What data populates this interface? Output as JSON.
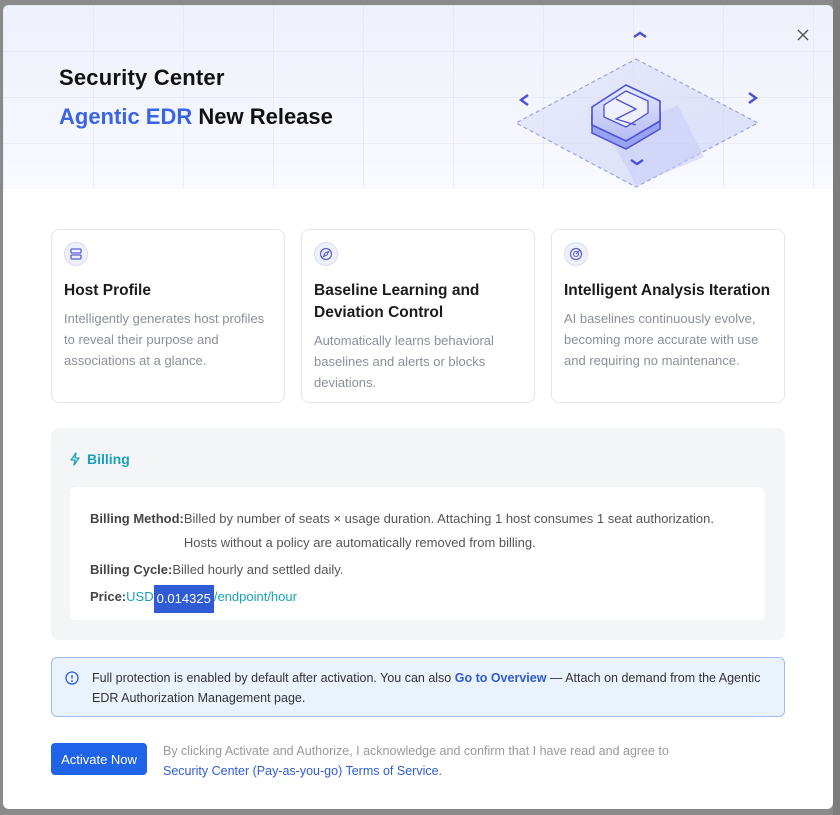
{
  "modal": {
    "title": "Security Center",
    "subtitle_accent": "Agentic EDR",
    "subtitle_rest": " New Release",
    "close_icon": "close-icon"
  },
  "features": [
    {
      "icon": "server-stack-icon",
      "title": "Host Profile",
      "desc": "Intelligently generates host profiles to reveal their purpose and associations at a glance."
    },
    {
      "icon": "compass-icon",
      "title": "Baseline Learning and Deviation Control",
      "desc": "Automatically learns behavioral baselines and alerts or blocks deviations."
    },
    {
      "icon": "radar-icon",
      "title": "Intelligent Analysis Iteration",
      "desc": "AI baselines continuously evolve, becoming more accurate with use and requiring no maintenance."
    }
  ],
  "billing": {
    "heading": "Billing",
    "method_label": "Billing Method:",
    "method_value": "Billed by number of seats × usage duration. Attaching 1 host consumes 1 seat authorization.",
    "method_value_2": "Hosts without a policy are automatically removed from billing.",
    "cycle_label": "Billing Cycle:",
    "cycle_value": "Billed hourly and settled daily.",
    "price_label": "Price:",
    "price_currency": "USD ",
    "price_number": "0.014325",
    "price_unit": "/endpoint/hour"
  },
  "notice": {
    "text_before": "Full protection is enabled by default after activation. You can also ",
    "link": "Go to Overview",
    "text_after": " — Attach on demand from the Agentic EDR Authorization Management page."
  },
  "footer": {
    "activate_label": "Activate Now",
    "terms_text": "By clicking Activate and Authorize, I acknowledge and confirm that I have read and agree to",
    "terms_link": "Security Center (Pay-as-you-go) Terms of Service."
  },
  "colors": {
    "accent": "#3a64e6",
    "primary_button": "#1f63e8",
    "billing_teal": "#1aa1b8",
    "notice_bg": "#eaf2fe"
  }
}
